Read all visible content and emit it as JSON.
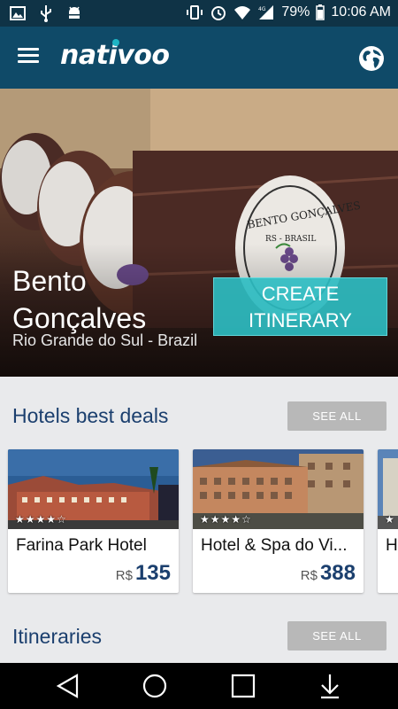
{
  "status_bar": {
    "battery": "79%",
    "time": "10:06 AM",
    "network": "4G"
  },
  "app_bar": {
    "logo": "nativoo",
    "menu_icon": "hamburger-menu-icon",
    "globe_icon": "globe-icon"
  },
  "hero": {
    "city": "Bento Gonçalves",
    "region": "Rio Grande do Sul - Brazil",
    "cta_label": "CREATE ITINERARY",
    "barrel_text_1": "BENTO GONÇALVES",
    "barrel_text_2": "RS - BRASIL"
  },
  "hotels": {
    "title": "Hotels best deals",
    "see_all": "SEE ALL",
    "items": [
      {
        "name": "Farina Park Hotel",
        "currency": "R$",
        "price": "135",
        "stars": "★★★★☆",
        "rating": 4
      },
      {
        "name": "Hotel & Spa do Vi...",
        "currency": "R$",
        "price": "388",
        "stars": "★★★★☆",
        "rating": 4
      },
      {
        "name": "H",
        "currency": "",
        "price": "",
        "stars": "★",
        "rating": 1
      }
    ]
  },
  "itineraries": {
    "title": "Itineraries",
    "see_all": "SEE ALL"
  },
  "colors": {
    "status_bar": "#0f3346",
    "app_bar": "#0f4a68",
    "accent": "#2cbfc4",
    "title_text": "#1b3f6e",
    "see_all_bg": "#b8b8b8"
  }
}
